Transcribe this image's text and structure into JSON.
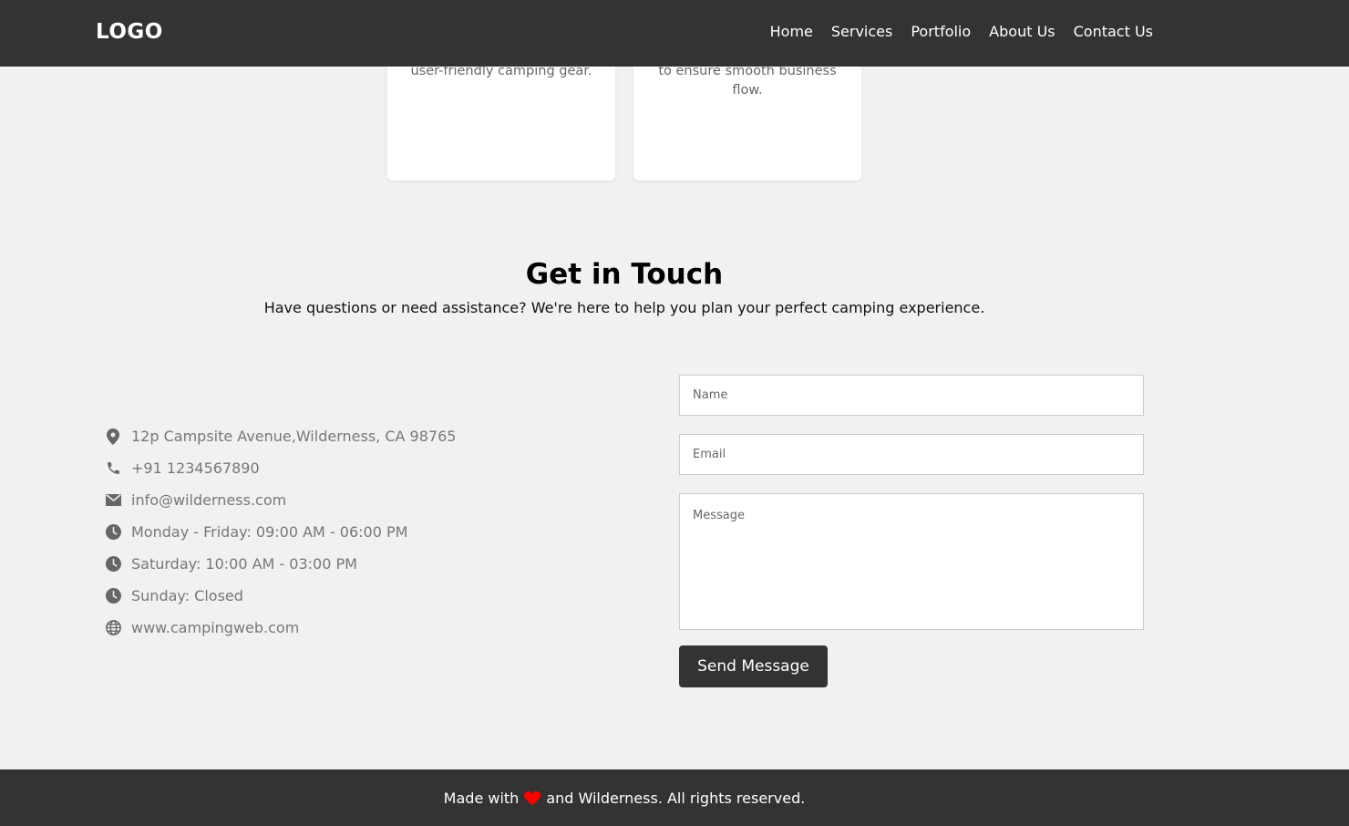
{
  "header": {
    "logo": "LOGO",
    "nav": [
      "Home",
      "Services",
      "Portfolio",
      "About Us",
      "Contact Us"
    ]
  },
  "cards": [
    {
      "text": "user-friendly camping gear."
    },
    {
      "text": "to ensure smooth business flow."
    }
  ],
  "contact": {
    "title": "Get in Touch",
    "subtitle": "Have questions or need assistance? We're here to help you plan your perfect camping experience.",
    "info": [
      {
        "icon": "map-pin-icon",
        "text": "12p Campsite Avenue,Wilderness, CA 98765"
      },
      {
        "icon": "phone-icon",
        "text": "+91 1234567890"
      },
      {
        "icon": "envelope-icon",
        "text": "info@wilderness.com"
      },
      {
        "icon": "clock-icon",
        "text": "Monday - Friday: 09:00 AM - 06:00 PM"
      },
      {
        "icon": "clock-icon",
        "text": "Saturday: 10:00 AM - 03:00 PM"
      },
      {
        "icon": "clock-icon",
        "text": "Sunday: Closed"
      },
      {
        "icon": "globe-icon",
        "text": "www.campingweb.com"
      }
    ],
    "form": {
      "name_placeholder": "Name",
      "email_placeholder": "Email",
      "message_placeholder": "Message",
      "submit_label": "Send Message"
    }
  },
  "footer": {
    "text_before": "Made with",
    "heart_icon": "heart-icon",
    "text_after": "and Wilderness. All rights reserved."
  },
  "colors": {
    "dark": "#333333",
    "background": "#f1f1f1",
    "heart": "#ff0000",
    "info_text": "#777777"
  }
}
